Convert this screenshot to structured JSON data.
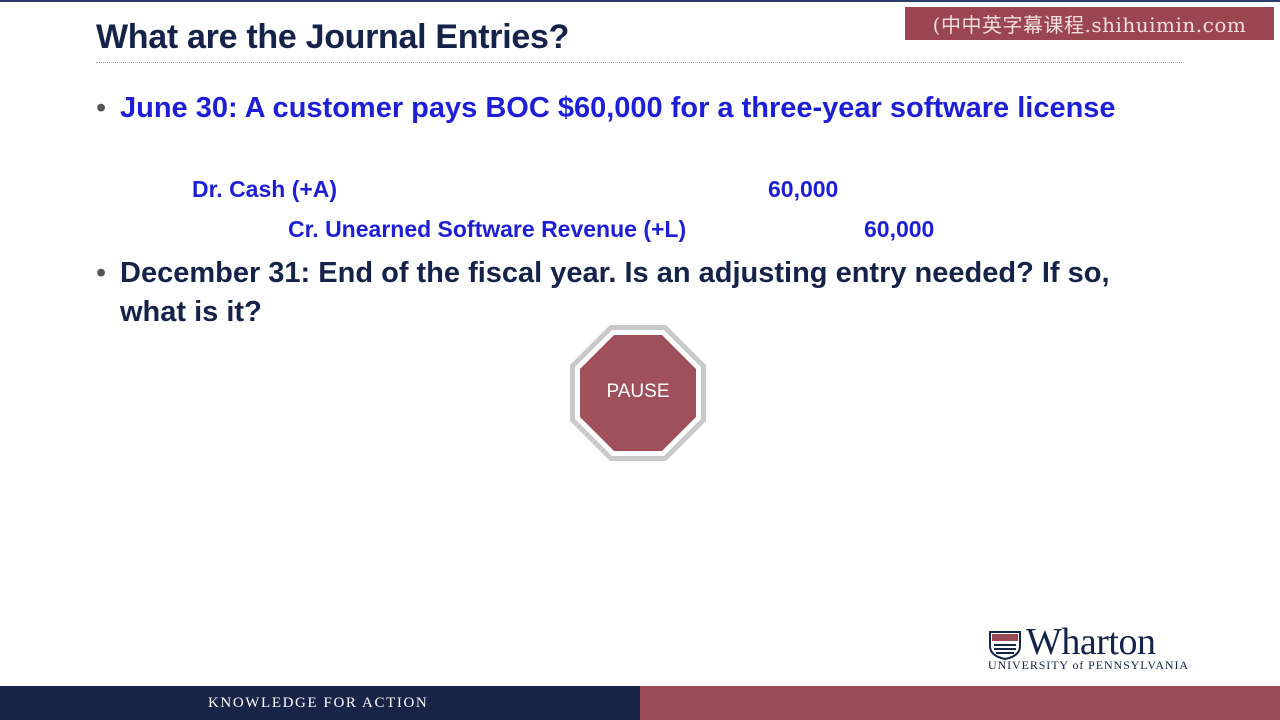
{
  "slide": {
    "title": "What are the Journal Entries?",
    "watermark": "(中中英字幕课程.shihuimin.com",
    "bullets": [
      "June 30: A customer pays BOC $60,000 for a three-year software license",
      "December 31: End of the fiscal year. Is an adjusting entry needed? If so, what is it?"
    ],
    "journal_entry": {
      "debit": {
        "account": "Dr. Cash (+A)",
        "amount": "60,000"
      },
      "credit": {
        "account": "Cr. Unearned Software Revenue (+L)",
        "amount": "60,000"
      }
    },
    "pause_label": "PAUSE"
  },
  "branding": {
    "logo_name": "Wharton",
    "logo_subtitle": "UNIVERSITY of PENNSYLVANIA",
    "footer_tagline": "KNOWLEDGE FOR ACTION"
  },
  "colors": {
    "navy": "#15224a",
    "blue_text": "#1d1fd8",
    "stop_red": "#a0505a",
    "footer_red": "#9a4a55"
  },
  "icons": {
    "stop": "stop-sign-icon",
    "logo": "penn-shield-icon"
  }
}
